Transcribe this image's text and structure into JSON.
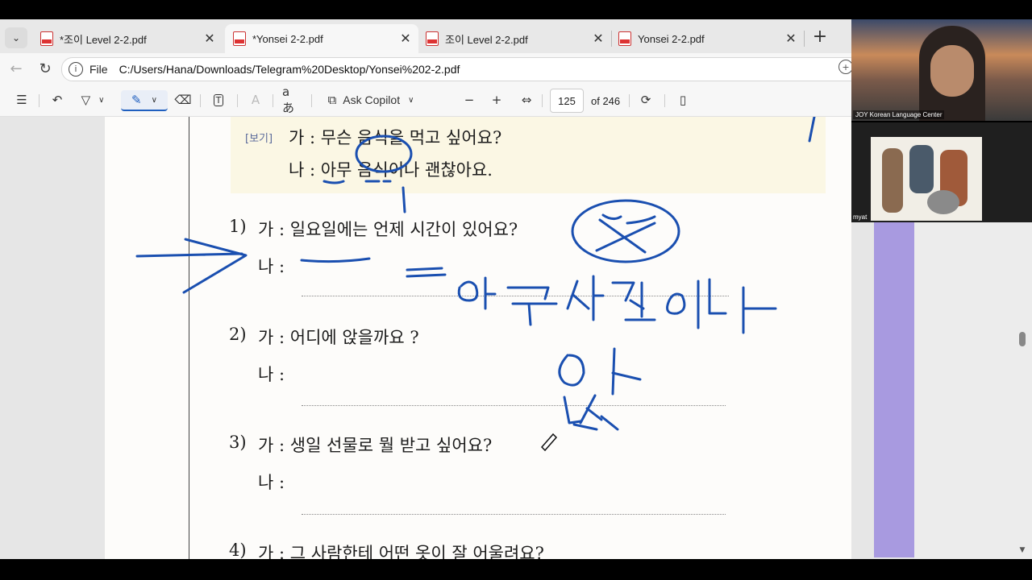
{
  "tabs": [
    {
      "title": "*조이 Level 2-2.pdf",
      "active": false
    },
    {
      "title": "*Yonsei 2-2.pdf",
      "active": true
    },
    {
      "title": "조이 Level 2-2.pdf",
      "active": false
    },
    {
      "title": "Yonsei 2-2.pdf",
      "active": false
    }
  ],
  "address": {
    "scheme_label": "File",
    "url": "C:/Users/Hana/Downloads/Telegram%20Desktop/Yonsei%202-2.pdf"
  },
  "toolbar": {
    "ask_copilot": "Ask Copilot",
    "page_number": "125",
    "page_count": "of 246",
    "read_aloud": "aあ"
  },
  "document": {
    "example_tag": "[보기]",
    "example_q": "가 : 무슨 음식을 먹고 싶어요?",
    "example_a": "나 : 아무 음식이나 괜찮아요.",
    "items": [
      {
        "num": "1)",
        "q": "가 : 일요일에는 언제 시간이 있어요?",
        "a": "나 :"
      },
      {
        "num": "2)",
        "q": "가 : 어디에 앉을까요 ?",
        "a": "나 :"
      },
      {
        "num": "3)",
        "q": "가 : 생일 선물로 뭘 받고 싶어요?",
        "a": "나 :"
      },
      {
        "num": "4)",
        "q": "가 : 그 사람한테 어떤 옷이 잘 어울려요?"
      }
    ]
  },
  "annotations": {
    "answer_1": "아무 시간이나",
    "correction": "앉",
    "crossed": "언제",
    "ink_color": "#1a4fb0"
  },
  "video": {
    "tile1_name": "JOY Korean Language Center",
    "tile2_name": "myat"
  }
}
